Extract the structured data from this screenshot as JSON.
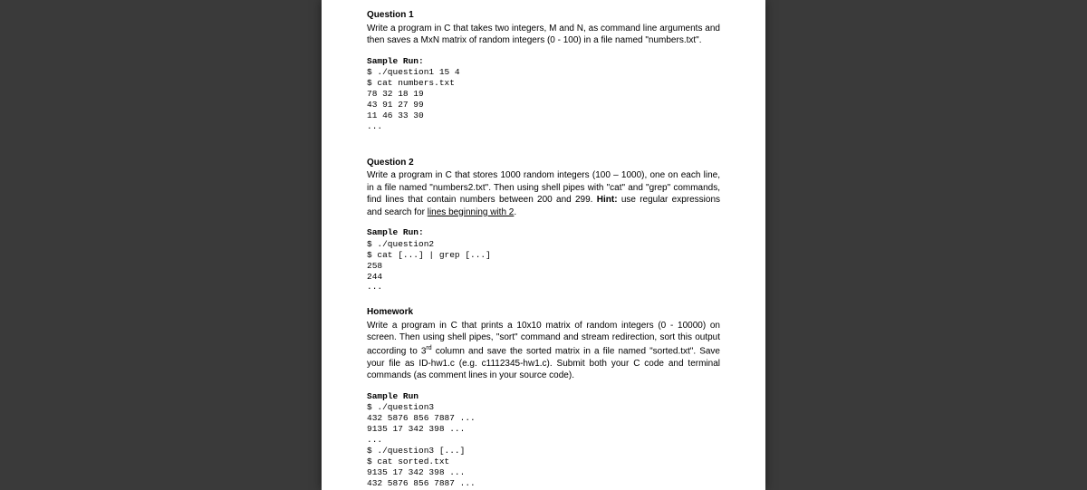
{
  "q1": {
    "title": "Question 1",
    "body": "Write a program in C that takes two integers, M and N, as command line arguments and then saves a MxN matrix of random integers (0 - 100) in a file named \"numbers.txt\".",
    "sample_label": "Sample Run:",
    "code": "$ ./question1 15 4\n$ cat numbers.txt\n78 32 18 19\n43 91 27 99\n11 46 33 30\n..."
  },
  "q2": {
    "title": "Question 2",
    "body_part1": "Write a program in C that stores 1000 random integers (100 – 1000), one on each line, in a file named \"numbers2.txt\". Then using shell pipes with \"cat\" and \"grep\" commands, find lines that contain numbers between 200 and 299. ",
    "body_hint": "Hint:",
    "body_part2": " use regular expressions and search for ",
    "body_underline": "lines beginning with 2",
    "body_part3": ".",
    "sample_label": "Sample Run:",
    "code": "$ ./question2\n$ cat [...] | grep [...]\n258\n244\n..."
  },
  "hw": {
    "title": "Homework",
    "body_part1": "Write a program in C that prints a 10x10 matrix of random integers (0 - 10000) on screen. Then using shell pipes, \"sort\" command and stream redirection, sort this output according to 3",
    "body_sup": "rd",
    "body_part2": " column and save the sorted matrix in a file named \"sorted.txt\". Save your file as ID-hw1.c (e.g. c1112345-hw1.c). Submit both your C code and terminal commands (as comment lines in your source code).",
    "sample_label": "Sample Run",
    "code": "$ ./question3\n432 5876 856 7887 ...\n9135 17 342 398 ...\n...\n$ ./question3 [...]\n$ cat sorted.txt\n9135 17 342 398 ...\n432 5876 856 7887 ..."
  }
}
